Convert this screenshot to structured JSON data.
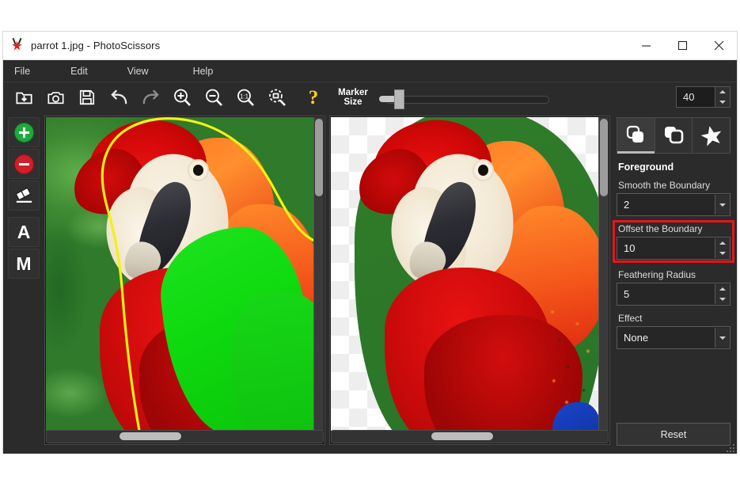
{
  "window": {
    "title": "parrot 1.jpg - PhotoScissors",
    "app_icon": "scissors-star-icon",
    "controls": {
      "minimize": "minimize-icon",
      "maximize": "maximize-icon",
      "close": "close-icon"
    }
  },
  "menu": {
    "items": [
      {
        "label": "File"
      },
      {
        "label": "Edit"
      },
      {
        "label": "View"
      },
      {
        "label": "Help"
      }
    ]
  },
  "toolbar": {
    "buttons": [
      {
        "name": "open-image-icon"
      },
      {
        "name": "camera-icon"
      },
      {
        "name": "save-icon"
      },
      {
        "name": "undo-icon"
      },
      {
        "name": "redo-icon"
      },
      {
        "name": "zoom-in-icon"
      },
      {
        "name": "zoom-out-icon"
      },
      {
        "name": "zoom-actual-size-icon"
      },
      {
        "name": "zoom-fit-icon"
      }
    ],
    "help_label": "?",
    "marker_size_label_line1": "Marker",
    "marker_size_label_line2": "Size",
    "marker_size_value": "40",
    "marker_size_min": 0,
    "marker_size_max": 100
  },
  "tools": {
    "items": [
      {
        "name": "foreground-marker-tool",
        "icon": "green-plus-circle-icon",
        "label": ""
      },
      {
        "name": "background-marker-tool",
        "icon": "red-minus-circle-icon",
        "label": ""
      },
      {
        "name": "eraser-tool",
        "icon": "eraser-icon",
        "label": ""
      },
      {
        "name": "auto-mode-tool",
        "icon": "letter-a-icon",
        "label": "A"
      },
      {
        "name": "manual-mode-tool",
        "icon": "letter-m-icon",
        "label": "M"
      }
    ]
  },
  "panes": {
    "left": {
      "name": "source-image-pane",
      "alt": "parrot with yellow selection outline and green foreground marker"
    },
    "right": {
      "name": "result-image-pane",
      "alt": "cut-out parrot on transparent checkerboard"
    }
  },
  "settings": {
    "tabs": [
      {
        "name": "tab-background",
        "icon": "layers-front-icon",
        "active": true
      },
      {
        "name": "tab-foreground",
        "icon": "layers-back-icon",
        "active": false
      },
      {
        "name": "tab-effects",
        "icon": "star-icon",
        "active": false
      }
    ],
    "section_title": "Foreground",
    "fields": [
      {
        "label": "Smooth the Boundary",
        "value": "2",
        "control": "dropdown"
      },
      {
        "label": "Offset the Boundary",
        "value": "10",
        "control": "spinner",
        "highlighted": true
      },
      {
        "label": "Feathering Radius",
        "value": "5",
        "control": "spinner"
      },
      {
        "label": "Effect",
        "value": "None",
        "control": "dropdown"
      }
    ],
    "reset_label": "Reset",
    "highlight_color": "#e8131a"
  },
  "colors": {
    "window_bg": "#2b2b2b",
    "titlebar_bg": "#ffffff",
    "accent_help": "#ffd21e",
    "marker_green": "#12d912",
    "outline_yellow": "#f2f211",
    "tool_green": "#1faa3c",
    "tool_red": "#d01f2a"
  }
}
